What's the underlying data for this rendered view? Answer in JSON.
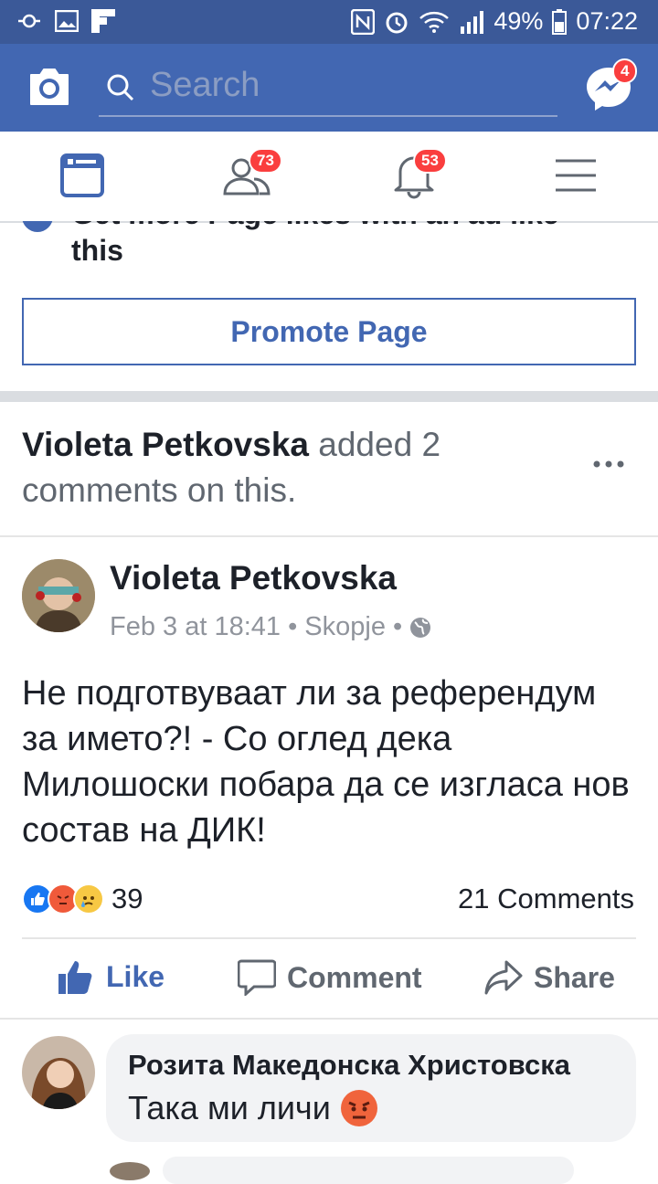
{
  "status_bar": {
    "battery": "49%",
    "time": "07:22"
  },
  "header": {
    "search_placeholder": "Search",
    "messenger_badge": "4"
  },
  "nav": {
    "friends_badge": "73",
    "notifications_badge": "53"
  },
  "promo": {
    "partial_text": "Get more Page likes with an ad like",
    "text_tail": "this",
    "button": "Promote Page"
  },
  "activity": {
    "actor": "Violeta Petkovska",
    "action": " added 2 comments on this."
  },
  "post": {
    "author": "Violeta Petkovska",
    "meta": "Feb 3 at 18:41 • Skopje •",
    "body": "Не подготвуваат ли за референдум за името?! - Со оглед дека Милошоски побара да се изгласа нов состав на ДИК!",
    "reaction_count": "39",
    "comments_count": "21 Comments",
    "actions": {
      "like": "Like",
      "comment": "Comment",
      "share": "Share"
    }
  },
  "comment": {
    "author": "Розита Македонска Христовска",
    "text": "Така ми личи"
  },
  "colors": {
    "brand": "#4267b2",
    "status": "#3b5998",
    "badge": "#fa3e3e",
    "link": "#4267b2"
  }
}
